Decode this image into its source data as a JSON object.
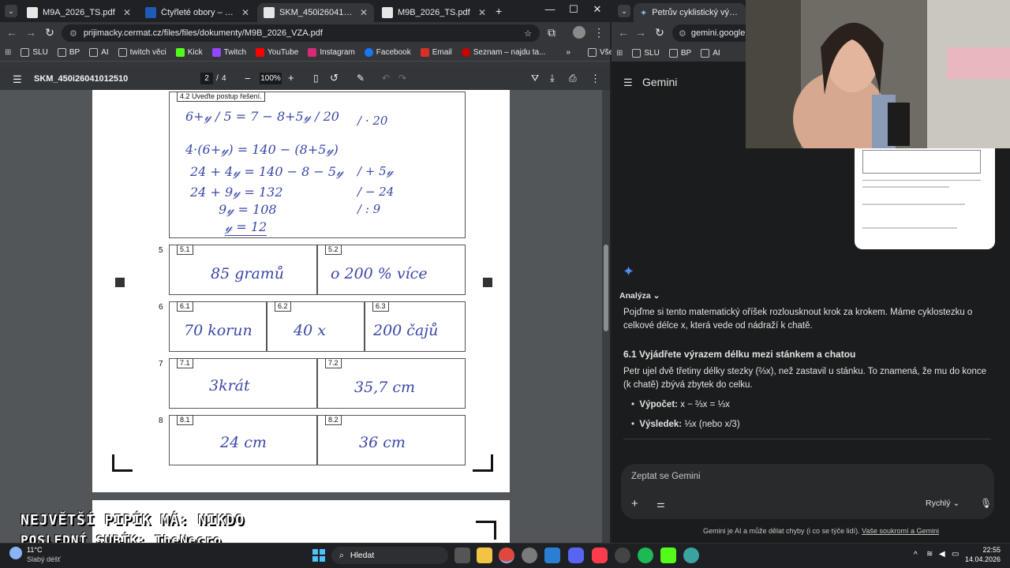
{
  "left_browser": {
    "tabs": [
      {
        "title": "M9A_2026_TS.pdf",
        "active": false
      },
      {
        "title": "Čtyřleté obory – Matematika",
        "active": false
      },
      {
        "title": "SKM_450i26041012510",
        "active": true
      },
      {
        "title": "M9B_2026_TS.pdf",
        "active": false
      }
    ],
    "new_tab": "+",
    "url": "prijimacky.cermat.cz/files/files/dokumenty/M9B_2026_VZA.pdf",
    "bookmarks": [
      "SLU",
      "BP",
      "AI",
      "twitch věci",
      "Kick",
      "Twitch",
      "YouTube",
      "Instagram",
      "Facebook",
      "Email",
      "Seznam – najdu ta..."
    ],
    "bookmarks_more": "»",
    "all_bookmarks": "Všechny záložky",
    "pdf": {
      "filename": "SKM_450i26041012510",
      "page_current": "2",
      "page_total": "4",
      "zoom": "100%"
    }
  },
  "worksheet": {
    "task42_label": "4.2  Uveďte postup řešení.",
    "lines": [
      {
        "left": "6+𝓎 / 5 = 7 − 8+5𝓎 / 20",
        "right": "/ · 20"
      },
      {
        "left": "4·(6+𝓎) = 140 − (8+5𝓎)",
        "right": ""
      },
      {
        "left": "24 + 4𝓎 = 140 − 8 − 5𝓎",
        "right": "/ + 5𝓎"
      },
      {
        "left": "24 + 9𝓎 = 132",
        "right": "/ − 24"
      },
      {
        "left": "9𝓎 = 108",
        "right": "/ : 9"
      },
      {
        "left": "𝓎 = 12",
        "right": ""
      }
    ],
    "rows": [
      {
        "num": "5",
        "cells": [
          {
            "id": "5.1",
            "answer": "85 gramů"
          },
          {
            "id": "5.2",
            "answer": "o 200 % více"
          }
        ]
      },
      {
        "num": "6",
        "cells": [
          {
            "id": "6.1",
            "answer": "70 korun"
          },
          {
            "id": "6.2",
            "answer": "40 x"
          },
          {
            "id": "6.3",
            "answer": "200 čajů"
          }
        ]
      },
      {
        "num": "7",
        "cells": [
          {
            "id": "7.1",
            "answer": "3krát"
          },
          {
            "id": "7.2",
            "answer": "35,7 cm"
          }
        ]
      },
      {
        "num": "8",
        "cells": [
          {
            "id": "8.1",
            "answer": "24 cm"
          },
          {
            "id": "8.2",
            "answer": "36 cm"
          }
        ]
      }
    ]
  },
  "right_browser": {
    "tab_title": "Petrův cyklistický výpočet trasy",
    "url": "gemini.google.c",
    "bookmarks": [
      "SLU",
      "BP",
      "AI"
    ],
    "app_title": "Gemini",
    "analysis_label": "Analýza",
    "intro": "Pojďme si tento matematický oříšek rozlousknout krok za krokem. Máme cyklostezku o celkové délce x, která vede od nádraží k chatě.",
    "section_title": "6.1 Vyjádřete výrazem délku mezi stánkem a chatou",
    "section_text": "Petr ujel dvě třetiny délky stezky (⅔x), než zastavil u stánku. To znamená, že mu do konce (k chatě) zbývá zbytek do celku.",
    "bullets": [
      {
        "label": "Výpočet:",
        "value": "x − ⅔x = ⅓x"
      },
      {
        "label": "Výsledek:",
        "value": "⅓x (nebo x/3)"
      }
    ],
    "prompt_placeholder": "Zeptat se Gemini",
    "mode": "Rychlý",
    "footer": "Gemini je AI a může dělat chyby (i co se týče lidí).",
    "footer_link": "Vaše soukromí a Gemini"
  },
  "overlay": {
    "line1": "NEJVĚTŠÍ PIPÍK MÁ: NIKDO",
    "line2": "POSLEDNÍ SUBÍK: TheNecro"
  },
  "taskbar": {
    "weather_temp": "11°C",
    "weather_desc": "Slabý déšť",
    "search": "Hledat",
    "time": "22:55",
    "date": "14.04.2026"
  }
}
